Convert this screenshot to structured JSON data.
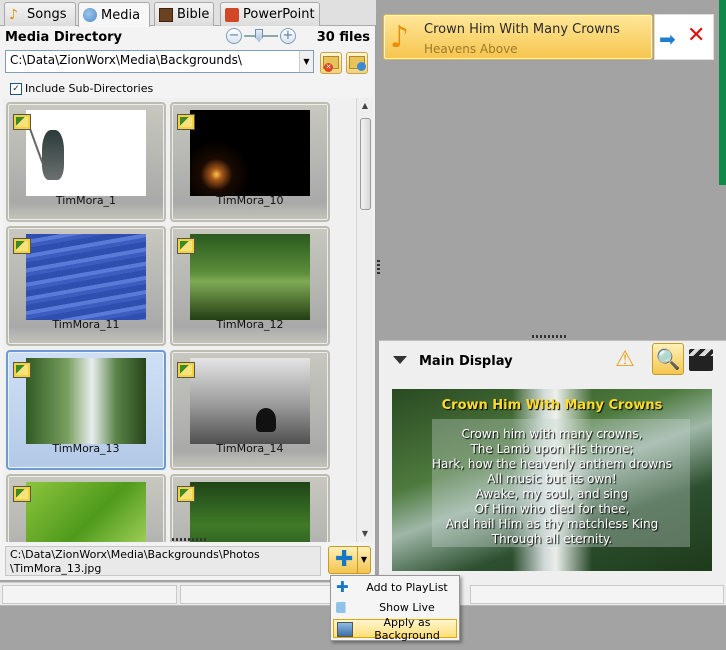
{
  "tabs": [
    {
      "label": "Songs",
      "icon": "music-note-icon"
    },
    {
      "label": "Media",
      "icon": "media-icon"
    },
    {
      "label": "Bible",
      "icon": "bible-icon"
    },
    {
      "label": "PowerPoint",
      "icon": "powerpoint-icon"
    }
  ],
  "media": {
    "title": "Media Directory",
    "file_count": "30 files",
    "path": "C:\\Data\\ZionWorx\\Media\\Backgrounds\\",
    "include_subdirs_label": "Include Sub-Directories",
    "include_subdirs_checked": true,
    "items": [
      {
        "label": "TimMora_1"
      },
      {
        "label": "TimMora_10"
      },
      {
        "label": "TimMora_11"
      },
      {
        "label": "TimMora_12"
      },
      {
        "label": "TimMora_13",
        "selected": true
      },
      {
        "label": "TimMora_14"
      },
      {
        "label": ""
      },
      {
        "label": ""
      }
    ],
    "selected_file_line1": "C:\\Data\\ZionWorx\\Media\\Backgrounds\\Photos",
    "selected_file_line2": "\\TimMora_13.jpg"
  },
  "context_menu": {
    "items": [
      {
        "label": "Add to PlayList",
        "icon": "add-icon"
      },
      {
        "label": "Show Live",
        "icon": "camera-icon"
      },
      {
        "label": "Apply as Background",
        "icon": "image-icon",
        "highlighted": true
      }
    ]
  },
  "playlist": {
    "song_title": "Crown Him With Many Crowns",
    "song_subtitle": "Heavens Above"
  },
  "main_display": {
    "title": "Main Display",
    "preview_title": "Crown Him With Many Crowns",
    "lyrics": [
      "Crown him with many crowns,",
      "The Lamb upon His throne;",
      "Hark, how the heavenly anthem drowns",
      "All music but its own!",
      "Awake, my soul, and sing",
      "Of Him who died for thee,",
      "And hail Him as thy matchless King",
      "Through all eternity."
    ]
  },
  "colors": {
    "selection": "#6b9bd1",
    "accent_gold": "#f6c54e",
    "preview_title": "#ffdc2a"
  }
}
